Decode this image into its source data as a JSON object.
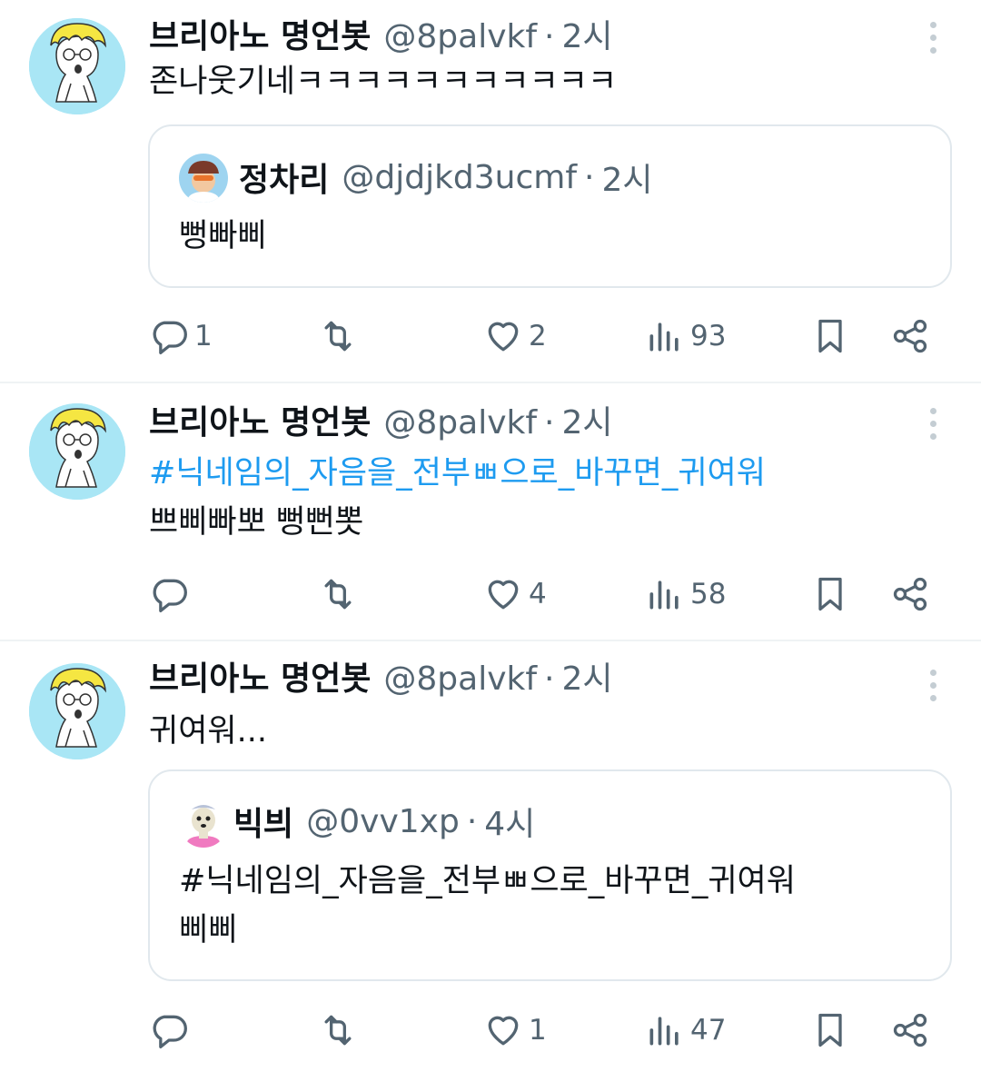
{
  "tweets": [
    {
      "author": "브리아노 명언봇",
      "handle": "@8palvkf",
      "dot": "·",
      "time": "2시",
      "text": "존나웃기네ㅋㅋㅋㅋㅋㅋㅋㅋㅋㅋㅋ",
      "quote": {
        "author": "정차리",
        "handle": "@djdjkd3ucmf",
        "dot": "·",
        "time": "2시",
        "text": "뻥빠삐"
      },
      "actions": {
        "replies": "1",
        "retweets": "",
        "likes": "2",
        "views": "93"
      }
    },
    {
      "author": "브리아노 명언봇",
      "handle": "@8palvkf",
      "dot": "·",
      "time": "2시",
      "hashtag": "#닉네임의_자음을_전부ㅃ으로_바꾸면_귀여워",
      "text": "쁘삐빠뽀 뻥뻔뽓",
      "actions": {
        "replies": "",
        "retweets": "",
        "likes": "4",
        "views": "58"
      }
    },
    {
      "author": "브리아노 명언봇",
      "handle": "@8palvkf",
      "dot": "·",
      "time": "2시",
      "text": "귀여워...",
      "quote": {
        "author": "빅븨",
        "handle": "@0vv1xp",
        "dot": "·",
        "time": "4시",
        "text_line1": "#닉네임의_자음을_전부ㅃ으로_바꾸면_귀여워",
        "text_line2": "삐삐"
      },
      "actions": {
        "replies": "",
        "retweets": "",
        "likes": "1",
        "views": "47"
      }
    }
  ],
  "icons": [
    "reply-icon",
    "retweet-icon",
    "like-icon",
    "views-icon",
    "bookmark-icon",
    "share-icon",
    "more-icon"
  ],
  "colors": {
    "text": "#0f1419",
    "secondary": "#536471",
    "link": "#1d9bf0",
    "border": "#e1e8ed",
    "avatar_bg": "#a9e6f5"
  }
}
